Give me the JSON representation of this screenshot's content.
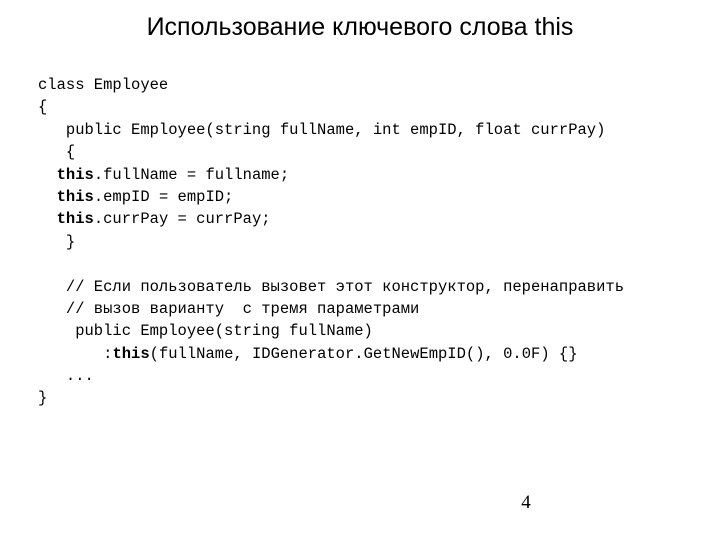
{
  "slide": {
    "title": "Использование ключевого слова this",
    "number": "4",
    "background_color": "#ffffff",
    "text_color": "#000000"
  },
  "code": {
    "language": "csharp",
    "lines": [
      {
        "id": "line-1",
        "indent": "",
        "pre": "class Employee",
        "keyword": "",
        "post": ""
      },
      {
        "id": "line-2",
        "indent": "",
        "pre": "{",
        "keyword": "",
        "post": ""
      },
      {
        "id": "line-3",
        "indent": "   ",
        "pre": "public Employee(string fullName, int empID, float currPay)",
        "keyword": "",
        "post": ""
      },
      {
        "id": "line-4",
        "indent": "   ",
        "pre": "{",
        "keyword": "",
        "post": ""
      },
      {
        "id": "line-5",
        "indent": "  ",
        "pre": "",
        "keyword": "this",
        "post": ".fullName = fullname;"
      },
      {
        "id": "line-6",
        "indent": "  ",
        "pre": "",
        "keyword": "this",
        "post": ".empID = empID;"
      },
      {
        "id": "line-7",
        "indent": "  ",
        "pre": "",
        "keyword": "this",
        "post": ".currPay = currPay;"
      },
      {
        "id": "line-8",
        "indent": "   ",
        "pre": "}",
        "keyword": "",
        "post": ""
      },
      {
        "id": "line-9",
        "indent": "",
        "pre": "",
        "keyword": "",
        "post": ""
      },
      {
        "id": "line-10",
        "indent": "   ",
        "pre": "// Если пользователь вызовет этот конструктор, перенаправить",
        "keyword": "",
        "post": ""
      },
      {
        "id": "line-11",
        "indent": "   ",
        "pre": "// вызов варианту  с тремя параметрами",
        "keyword": "",
        "post": ""
      },
      {
        "id": "line-12",
        "indent": "   ",
        "pre": " public Employee(string fullName)",
        "keyword": "",
        "post": ""
      },
      {
        "id": "line-13",
        "indent": "       ",
        "pre": ":",
        "keyword": "this",
        "post": "(fullName, IDGenerator.GetNewEmpID(), 0.0F) {}"
      },
      {
        "id": "line-14",
        "indent": "   ",
        "pre": "...",
        "keyword": "",
        "post": ""
      },
      {
        "id": "line-15",
        "indent": "",
        "pre": "}",
        "keyword": "",
        "post": ""
      }
    ]
  }
}
